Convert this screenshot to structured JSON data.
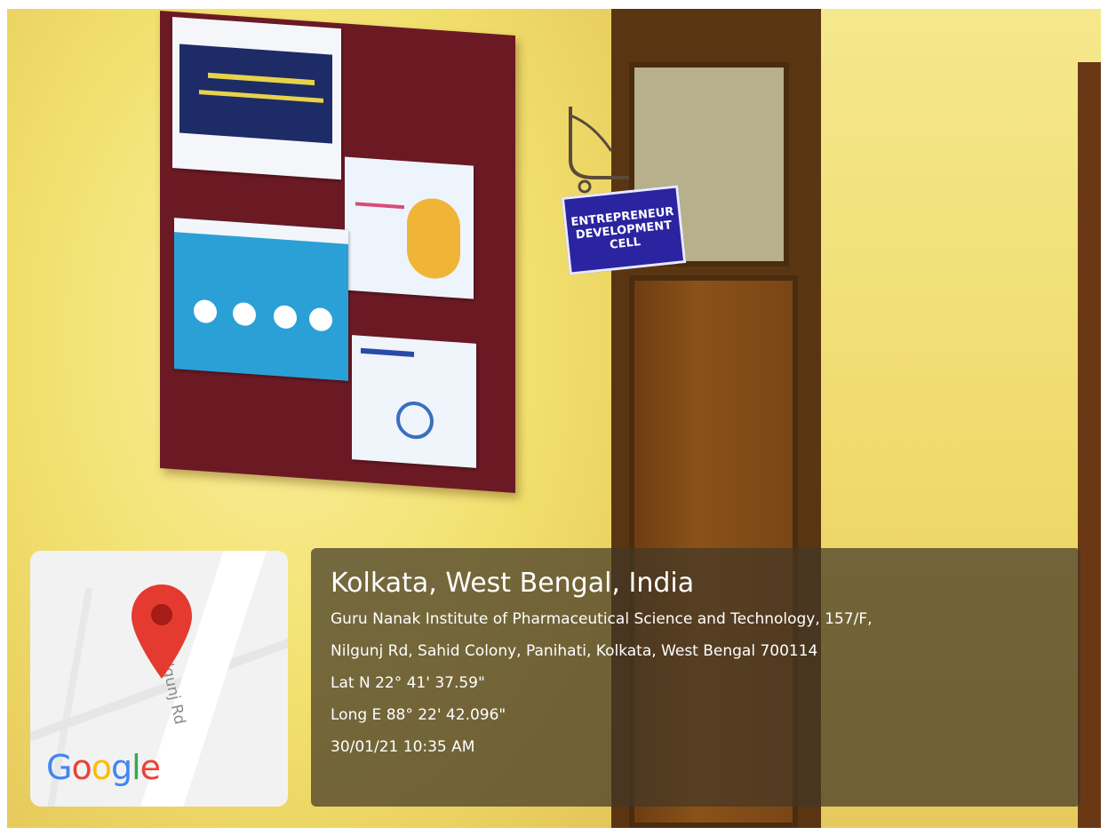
{
  "photo": {
    "sign_lines": [
      "ENTREPRENEUR",
      "DEVELOPMENT",
      "CELL"
    ]
  },
  "map_card": {
    "road_label": "Nilgunj Rd",
    "logo_text": "Google",
    "pin_color": "#e53a2f"
  },
  "location": {
    "title": "Kolkata, West Bengal, India",
    "address_line1": "Guru Nanak Institute of Pharmaceutical Science and Technology, 157/F,",
    "address_line2": "Nilgunj Rd, Sahid Colony, Panihati, Kolkata, West Bengal 700114",
    "latitude": "Lat N 22° 41' 37.59\"",
    "longitude": "Long E 88° 22' 42.096\"",
    "timestamp": "30/01/21 10:35 AM"
  }
}
